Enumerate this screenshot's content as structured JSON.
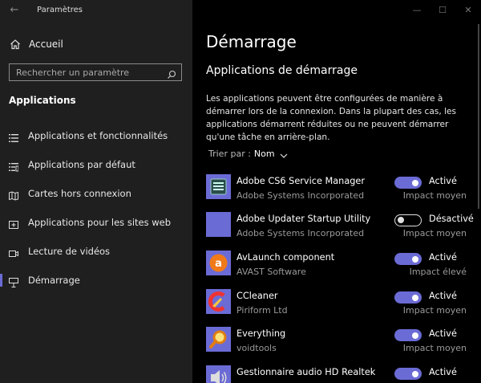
{
  "window": {
    "title": "Paramètres",
    "back_glyph": "←",
    "controls": [
      "—",
      "☐",
      "✕"
    ]
  },
  "sidebar": {
    "home_label": "Accueil",
    "search_placeholder": "Rechercher un paramètre",
    "section_title": "Applications",
    "items": [
      {
        "label": "Applications et fonctionnalités",
        "icon": "apps-features-icon",
        "selected": false
      },
      {
        "label": "Applications par défaut",
        "icon": "default-apps-icon",
        "selected": false
      },
      {
        "label": "Cartes hors connexion",
        "icon": "offline-maps-icon",
        "selected": false
      },
      {
        "label": "Applications pour les sites web",
        "icon": "apps-for-websites-icon",
        "selected": false
      },
      {
        "label": "Lecture de vidéos",
        "icon": "video-playback-icon",
        "selected": false
      },
      {
        "label": "Démarrage",
        "icon": "startup-icon",
        "selected": true
      }
    ]
  },
  "main": {
    "page_title": "Démarrage",
    "sub_title": "Applications de démarrage",
    "description": "Les applications peuvent être configurées de manière à démarrer lors de la connexion. Dans la plupart des cas, les applications démarrent réduites ou ne peuvent démarrer qu'une tâche en arrière-plan.",
    "sort_label": "Trier par :",
    "sort_value": "Nom",
    "apps": [
      {
        "name": "Adobe CS6 Service Manager",
        "publisher": "Adobe Systems Incorporated",
        "state": "Activé",
        "enabled": true,
        "impact": "Impact moyen",
        "icon": "adobe-cs6-icon"
      },
      {
        "name": "Adobe Updater Startup Utility",
        "publisher": "Adobe Systems Incorporated",
        "state": "Désactivé",
        "enabled": false,
        "impact": "Impact moyen",
        "icon": "adobe-updater-icon"
      },
      {
        "name": "AvLaunch component",
        "publisher": "AVAST Software",
        "state": "Activé",
        "enabled": true,
        "impact": "Impact élevé",
        "icon": "avast-icon"
      },
      {
        "name": "CCleaner",
        "publisher": "Piriform Ltd",
        "state": "Activé",
        "enabled": true,
        "impact": "Impact moyen",
        "icon": "ccleaner-icon"
      },
      {
        "name": "Everything",
        "publisher": "voidtools",
        "state": "Activé",
        "enabled": true,
        "impact": "Impact moyen",
        "icon": "everything-icon"
      },
      {
        "name": "Gestionnaire audio HD Realtek",
        "publisher": "",
        "state": "Activé",
        "enabled": true,
        "impact": "",
        "icon": "realtek-audio-icon"
      }
    ]
  },
  "colors": {
    "accent": "#6b6bd6",
    "sidebar_bg": "#1f1f1f",
    "main_bg": "#000000"
  }
}
